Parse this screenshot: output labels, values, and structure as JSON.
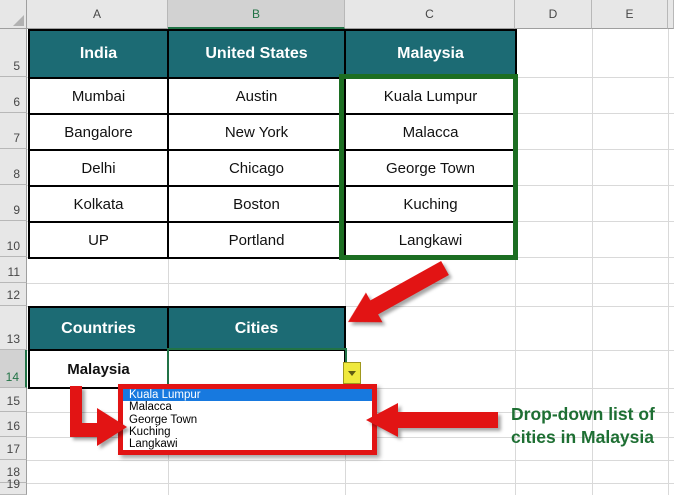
{
  "spreadsheet": {
    "column_headers": [
      "A",
      "B",
      "C",
      "D",
      "E"
    ],
    "row_headers": [
      "5",
      "6",
      "7",
      "8",
      "9",
      "10",
      "11",
      "12",
      "13",
      "14",
      "15",
      "16",
      "17",
      "18",
      "19"
    ],
    "selected_column": "B",
    "selected_row": "14"
  },
  "table1": {
    "headers": [
      "India",
      "United States",
      "Malaysia"
    ],
    "rows": [
      [
        "Mumbai",
        "Austin",
        "Kuala Lumpur"
      ],
      [
        "Bangalore",
        "New York",
        "Malacca"
      ],
      [
        "Delhi",
        "Chicago",
        "George Town"
      ],
      [
        "Kolkata",
        "Boston",
        "Kuching"
      ],
      [
        "UP",
        "Portland",
        "Langkawi"
      ]
    ]
  },
  "table2": {
    "headers": [
      "Countries",
      "Cities"
    ],
    "rows": [
      [
        "Malaysia",
        ""
      ]
    ]
  },
  "dropdown": {
    "items": [
      "Kuala Lumpur",
      "Malacca",
      "George Town",
      "Kuching",
      "Langkawi"
    ],
    "selected": "Kuala Lumpur"
  },
  "annotation": {
    "line1": "Drop-down list of",
    "line2": "cities in Malaysia"
  },
  "colors": {
    "header_teal": "#1c6b74",
    "selection_green": "#217346",
    "range_border_green": "#1c6e22",
    "annotation_red": "#e21414",
    "dropdown_selection_blue": "#1779df",
    "dropdown_button_yellow": "#efe93d",
    "annotation_text_green": "#1e6f33"
  }
}
